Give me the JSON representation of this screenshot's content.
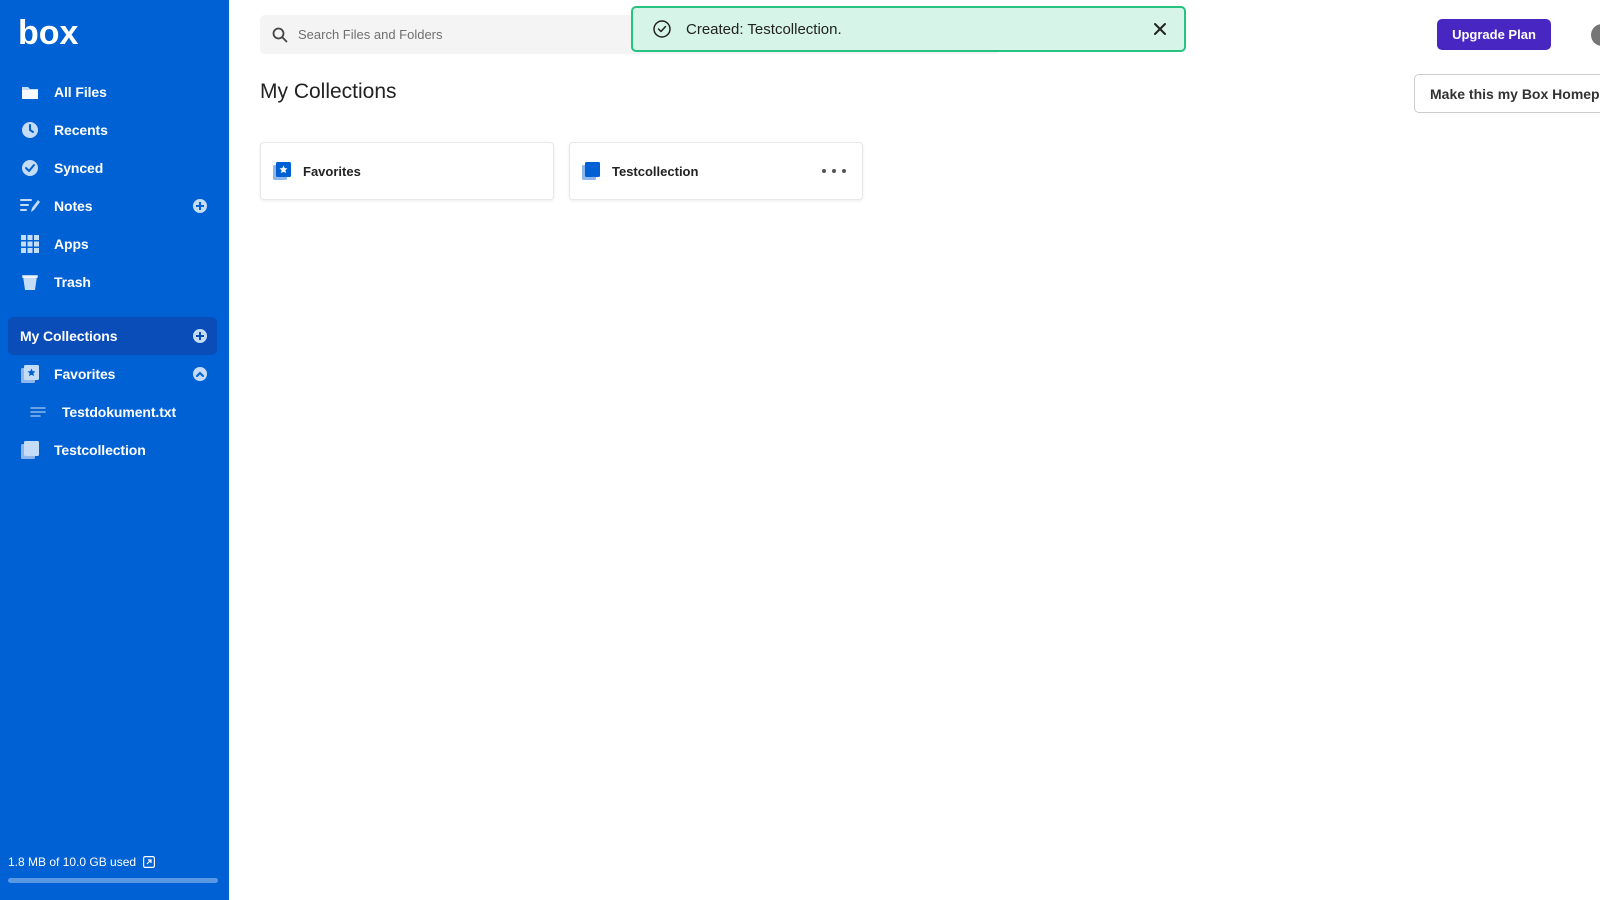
{
  "app": {
    "logo_text": "box"
  },
  "colors": {
    "sidebar": "#0061d5",
    "sidebar_active": "#0a4db8",
    "upgrade": "#4826c2",
    "toast_bg": "#d6f4e8",
    "toast_border": "#26c281"
  },
  "search": {
    "placeholder": "Search Files and Folders",
    "value": ""
  },
  "toast": {
    "message": "Created: Testcollection.",
    "icon": "check-circle-icon"
  },
  "header": {
    "upgrade_label": "Upgrade Plan",
    "homepage_label": "Make this my Box Homepage"
  },
  "sidebar": {
    "items": [
      {
        "label": "All Files",
        "icon": "folder-icon"
      },
      {
        "label": "Recents",
        "icon": "clock-icon"
      },
      {
        "label": "Synced",
        "icon": "check-circle-icon"
      },
      {
        "label": "Notes",
        "icon": "notes-icon"
      },
      {
        "label": "Apps",
        "icon": "grid-icon"
      },
      {
        "label": "Trash",
        "icon": "trash-icon"
      }
    ],
    "collections": {
      "header": "My Collections",
      "items": [
        {
          "label": "Favorites",
          "icon": "favorites-collection-icon"
        },
        {
          "label": "Testdokument.txt",
          "icon": "text-file-icon"
        },
        {
          "label": "Testcollection",
          "icon": "collection-icon"
        }
      ]
    },
    "storage": {
      "text": "1.8 MB of 10.0 GB used",
      "used_fraction": 0.0002
    }
  },
  "main": {
    "title": "My Collections",
    "cards": [
      {
        "label": "Favorites",
        "icon": "favorites-collection-icon"
      },
      {
        "label": "Testcollection",
        "icon": "collection-icon"
      }
    ]
  }
}
